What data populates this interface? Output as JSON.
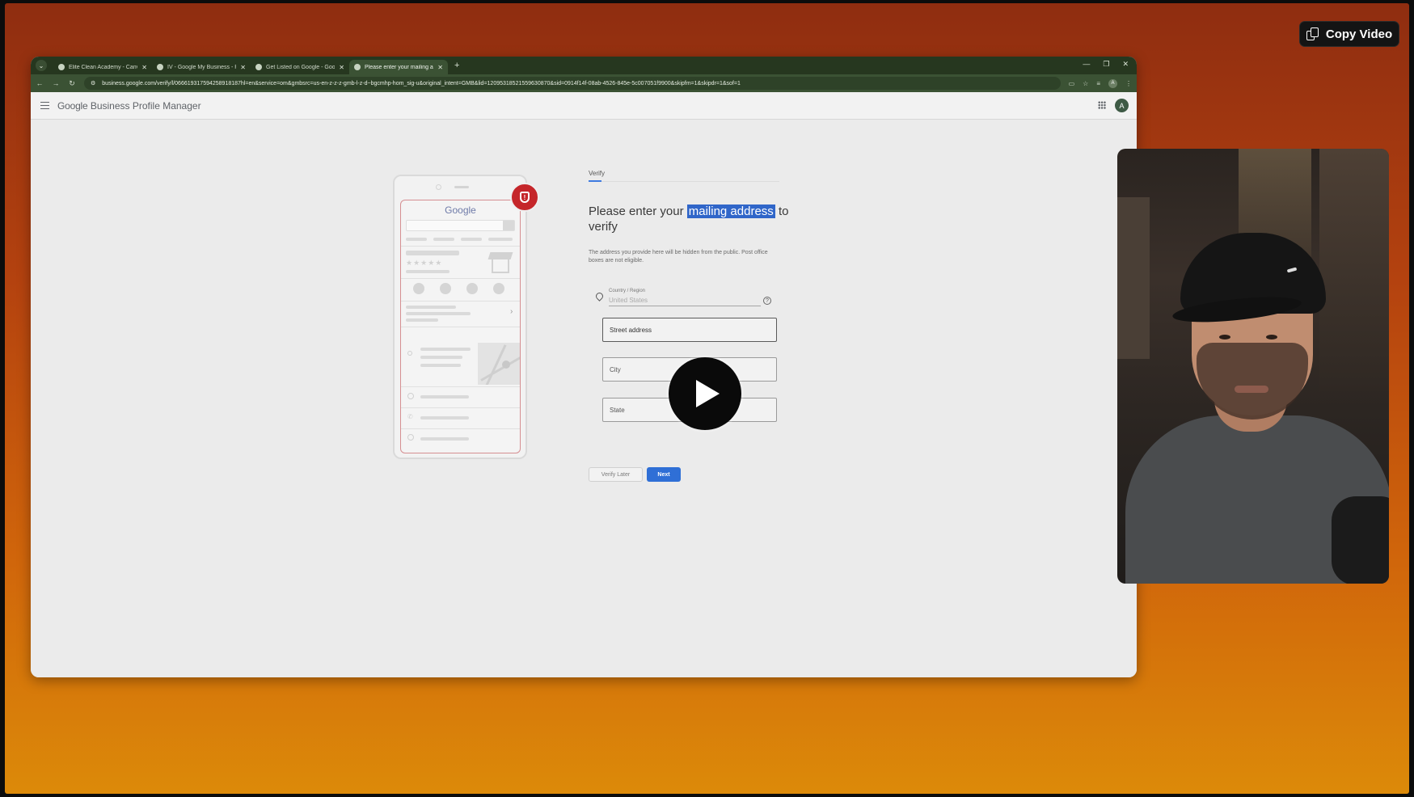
{
  "overlay": {
    "copy_video_label": "Copy Video",
    "copy_icon": "copy-icon"
  },
  "browser": {
    "tabs": [
      {
        "title": "Elite Clean Academy - Canva",
        "active": false
      },
      {
        "title": "IV - Google My Business - Prez",
        "active": false
      },
      {
        "title": "Get Listed on Google - Google",
        "active": false
      },
      {
        "title": "Please enter your mailing addr",
        "active": true
      }
    ],
    "new_tab_glyph": "+",
    "url": "business.google.com/verify/l/066619317594258918187hl=en&service=om&gmbsrc=us-en-z-z-z-gmb-l-z-d~bgcmhp-hom_sig-u&original_intent=GMB&lid=12095318521559630870&sid=0914f14f-08ab-4526-845e-5c007051f9900&skipfm=1&skipdr=1&sof=1"
  },
  "app": {
    "brand_google": "Google",
    "brand_rest": " Business Profile Manager",
    "avatar_letter": "A",
    "brand_color": "#5f6368"
  },
  "illustration": {
    "logo_text": "Google",
    "rating_stars": "★★★★★",
    "chevron": "›",
    "shield_glyph": "!",
    "shield_color": "#c5262a"
  },
  "form": {
    "tab_label": "Verify",
    "headline_before": "Please enter your ",
    "headline_highlight": "mailing address",
    "headline_after": " to verify",
    "description": "The address you provide here will be hidden from the public. Post office boxes are not eligible.",
    "country_label": "Country / Region",
    "country_value": "United States",
    "help_glyph": "?",
    "street_placeholder": "Street address",
    "city_placeholder": "City",
    "state_placeholder": "State",
    "verify_later_label": "Verify Later",
    "next_label": "Next",
    "accent_color": "#2f6fd6"
  },
  "player": {
    "play_icon": "play-icon"
  }
}
